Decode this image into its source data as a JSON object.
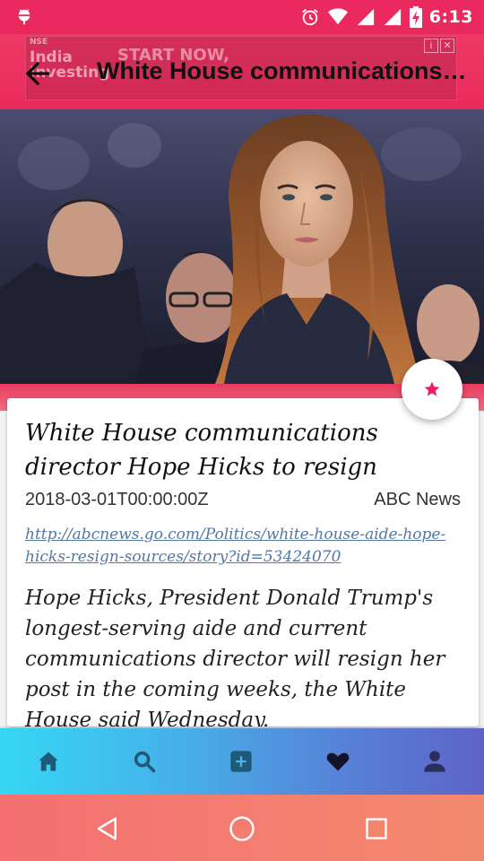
{
  "status_bar": {
    "time": "6:13",
    "icons": [
      "android-debug-icon",
      "alarm-icon",
      "wifi-icon",
      "signal-icon",
      "signal-icon",
      "battery-charging-icon"
    ]
  },
  "ad": {
    "logo_lines": [
      "NSE",
      "India",
      "Investing"
    ],
    "cta": "START NOW,"
  },
  "app_bar": {
    "title": "White House communications director Hope Hicks to resign",
    "back_icon": "arrow-left-icon"
  },
  "article": {
    "title": "White House communications director Hope Hicks to resign",
    "published_at": "2018-03-01T00:00:00Z",
    "source": "ABC News",
    "url": "http://abcnews.go.com/Politics/white-house-aide-hope-hicks-resign-sources/story?id=53424070",
    "description": "Hope Hicks, President Donald Trump's longest-serving aide and current communications director will resign her post in the coming weeks, the White House said Wednesday."
  },
  "fab": {
    "icon": "star-icon"
  },
  "bottom_nav": {
    "items": [
      {
        "name": "home",
        "icon": "home-icon"
      },
      {
        "name": "search",
        "icon": "search-icon"
      },
      {
        "name": "add",
        "icon": "add-box-icon"
      },
      {
        "name": "favorites",
        "icon": "heart-icon"
      },
      {
        "name": "profile",
        "icon": "person-icon"
      }
    ]
  },
  "colors": {
    "accent": "#ea2a5e",
    "nav_gradient_start": "#35d7f4",
    "nav_gradient_end": "#5e63c8",
    "nav_icon": "#1e5a78",
    "link": "#5278a6"
  }
}
